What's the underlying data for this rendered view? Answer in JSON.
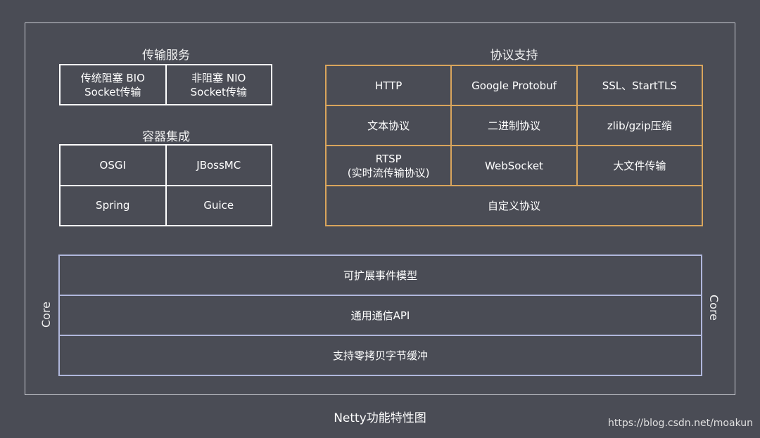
{
  "transport": {
    "title": "传输服务",
    "cells": [
      "传统阻塞 BIO\nSocket传输",
      "非阻塞 NIO\nSocket传输"
    ]
  },
  "container": {
    "title": "容器集成",
    "cells": [
      "OSGI",
      "JBossMC",
      "Spring",
      "Guice"
    ]
  },
  "protocol": {
    "title": "协议支持",
    "cells": [
      "HTTP",
      "Google Protobuf",
      "SSL、StartTLS",
      "文本协议",
      "二进制协议",
      "zlib/gzip压缩",
      "RTSP\n(实时流传输协议)",
      "WebSocket",
      "大文件传输",
      "自定义协议"
    ]
  },
  "core": {
    "label": "Core",
    "rows": [
      "可扩展事件模型",
      "通用通信API",
      "支持零拷贝字节缓冲"
    ]
  },
  "footer": {
    "title": "Netty功能特性图",
    "watermark": "https://blog.csdn.net/moakun"
  },
  "colors": {
    "background": "#4a4c55",
    "protocol_border": "#d9a55c",
    "core_border": "#b0b7dc"
  }
}
